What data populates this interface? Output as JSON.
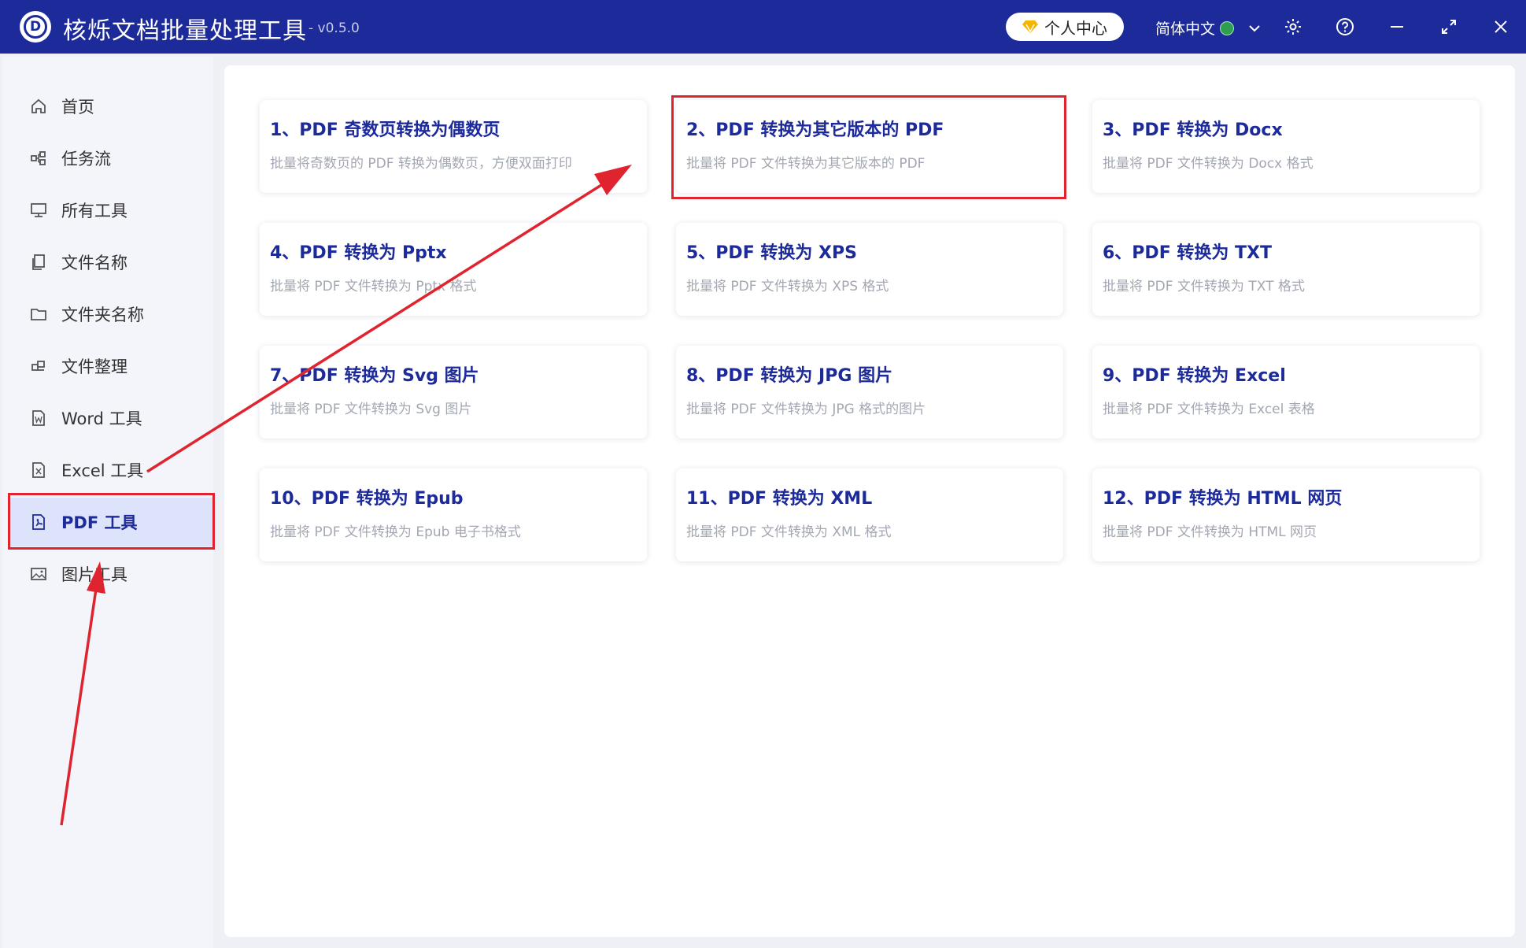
{
  "app": {
    "title": "核烁文档批量处理工具",
    "version": "- v0.5.0",
    "logo_letter": "D"
  },
  "header": {
    "user_center": "个人中心",
    "language": "简体中文"
  },
  "sidebar": {
    "items": [
      {
        "label": "首页",
        "icon": "home-icon"
      },
      {
        "label": "任务流",
        "icon": "workflow-icon"
      },
      {
        "label": "所有工具",
        "icon": "monitor-icon"
      },
      {
        "label": "文件名称",
        "icon": "file-copy-icon"
      },
      {
        "label": "文件夹名称",
        "icon": "folder-icon"
      },
      {
        "label": "文件整理",
        "icon": "organize-icon"
      },
      {
        "label": "Word 工具",
        "icon": "word-file-icon"
      },
      {
        "label": "Excel 工具",
        "icon": "excel-file-icon"
      },
      {
        "label": "PDF 工具",
        "icon": "pdf-file-icon",
        "active": true
      },
      {
        "label": "图片工具",
        "icon": "image-icon"
      }
    ]
  },
  "tools": [
    {
      "title": "1、PDF 奇数页转换为偶数页",
      "desc": "批量将奇数页的 PDF 转换为偶数页，方便双面打印"
    },
    {
      "title": "2、PDF 转换为其它版本的 PDF",
      "desc": "批量将 PDF 文件转换为其它版本的 PDF"
    },
    {
      "title": "3、PDF 转换为 Docx",
      "desc": "批量将 PDF 文件转换为 Docx 格式"
    },
    {
      "title": "4、PDF 转换为 Pptx",
      "desc": "批量将 PDF 文件转换为 Pptx 格式"
    },
    {
      "title": "5、PDF 转换为 XPS",
      "desc": "批量将 PDF 文件转换为 XPS 格式"
    },
    {
      "title": "6、PDF 转换为 TXT",
      "desc": "批量将 PDF 文件转换为 TXT 格式"
    },
    {
      "title": "7、PDF 转换为 Svg 图片",
      "desc": "批量将 PDF 文件转换为 Svg 图片"
    },
    {
      "title": "8、PDF 转换为 JPG 图片",
      "desc": "批量将 PDF 文件转换为 JPG 格式的图片"
    },
    {
      "title": "9、PDF 转换为 Excel",
      "desc": "批量将 PDF 文件转换为 Excel 表格"
    },
    {
      "title": "10、PDF 转换为 Epub",
      "desc": "批量将 PDF 文件转换为 Epub 电子书格式"
    },
    {
      "title": "11、PDF 转换为 XML",
      "desc": "批量将 PDF 文件转换为 XML 格式"
    },
    {
      "title": "12、PDF 转换为 HTML 网页",
      "desc": "批量将 PDF 文件转换为 HTML 网页"
    }
  ],
  "colors": {
    "brand": "#1d2a9a",
    "annotation_red": "#e0242f"
  }
}
